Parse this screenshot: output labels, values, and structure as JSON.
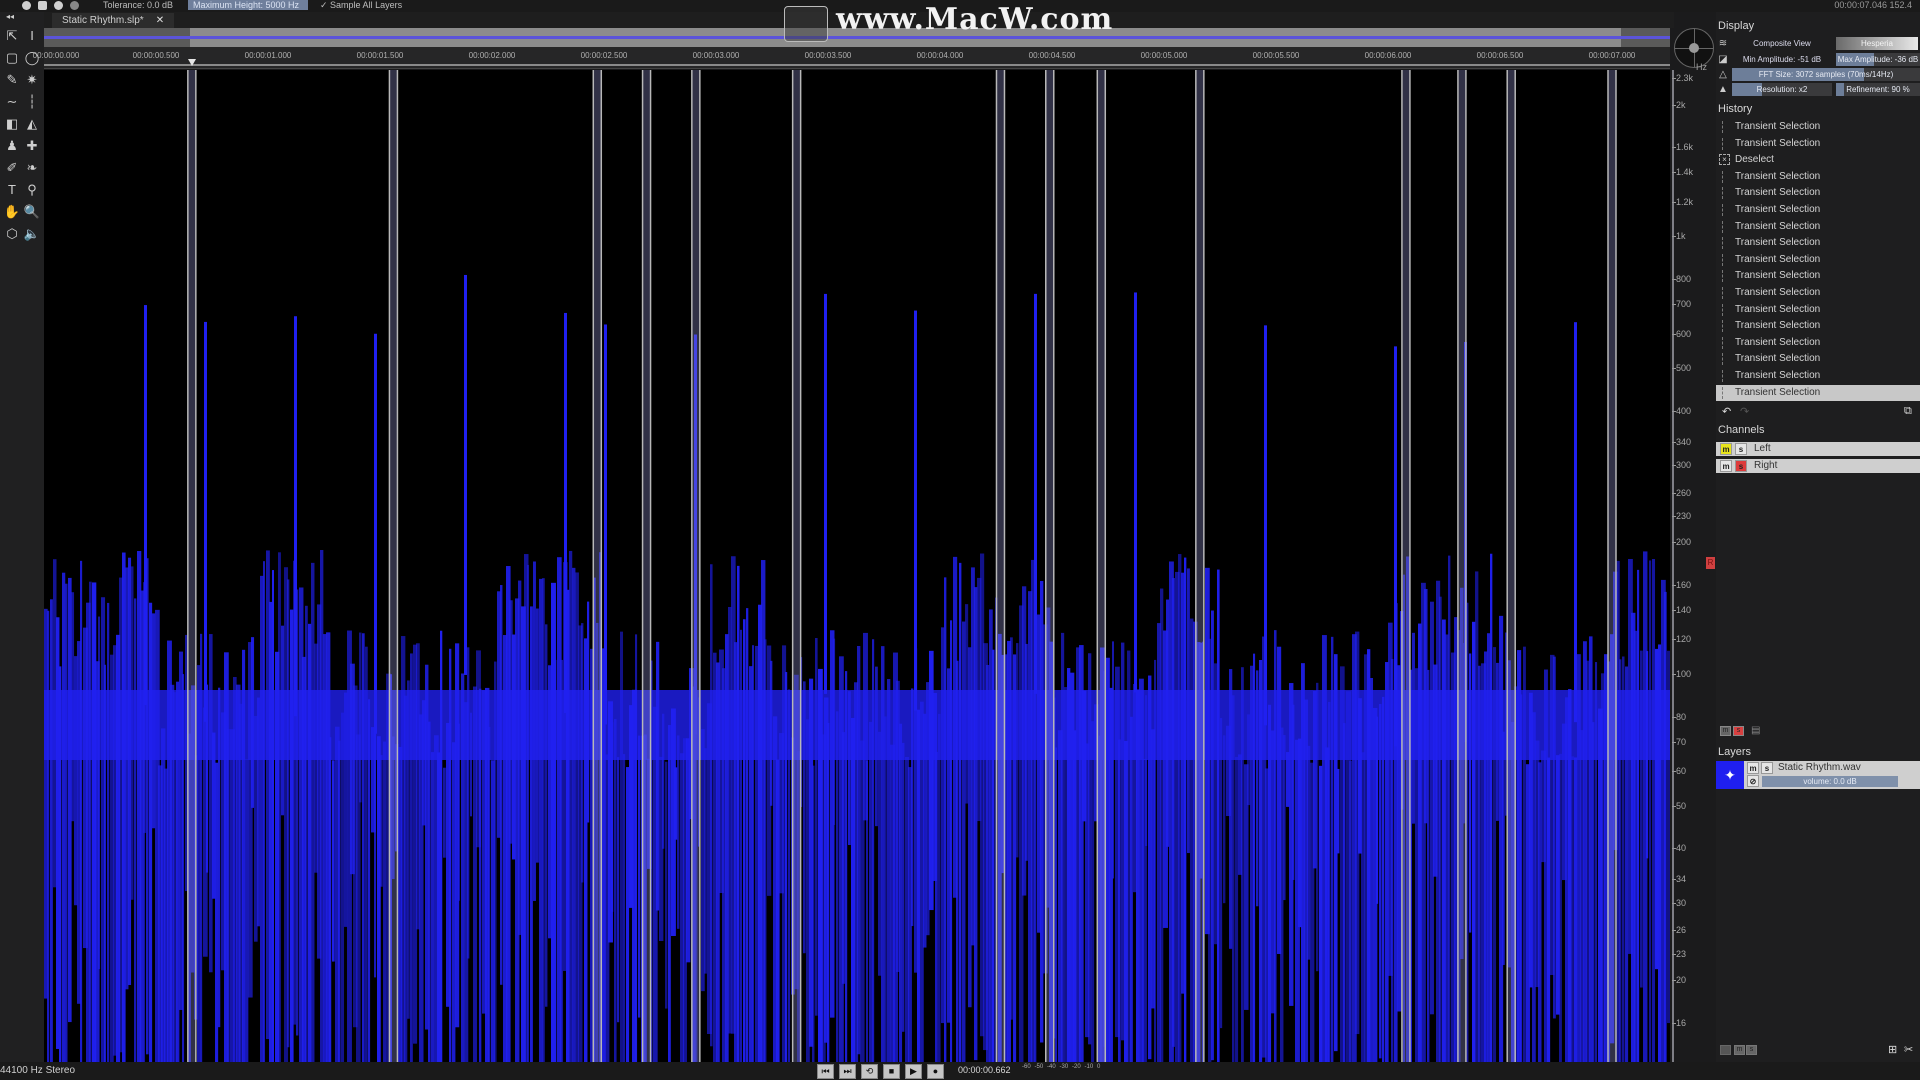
{
  "options_bar": {
    "tolerance": "Tolerance: 0.0 dB",
    "max_height": "Maximum Height: 5000 Hz",
    "sample_all_layers": "✓ Sample All Layers",
    "cursor_time": "00:00:07.046  152.4"
  },
  "watermark": "www.MacW.com",
  "document_tab": {
    "title": "Static Rhythm.slp*",
    "close": "✕"
  },
  "overview": {
    "visible_start_fraction": 0.09,
    "visible_end_fraction": 0.97
  },
  "ruler": {
    "labels": [
      "00:00:00.000",
      "00:00:00.500",
      "00:00:01.000",
      "00:00:01.500",
      "00:00:02.000",
      "00:00:02.500",
      "00:00:03.000",
      "00:00:03.500",
      "00:00:04.000",
      "00:00:04.500",
      "00:00:05.000",
      "00:00:05.500",
      "00:00:06.000",
      "00:00:06.500",
      "00:00:07.000"
    ],
    "playhead_seconds": 0.662
  },
  "tools": [
    {
      "name": "move-tool",
      "glyph": "⇱"
    },
    {
      "name": "time-selection-tool",
      "glyph": "I"
    },
    {
      "name": "rectangle-select-tool",
      "glyph": "▢"
    },
    {
      "name": "lasso-tool",
      "glyph": "◯"
    },
    {
      "name": "brush-select-tool",
      "glyph": "✎"
    },
    {
      "name": "magic-wand-tool",
      "glyph": "✷"
    },
    {
      "name": "harmonic-select-tool",
      "glyph": "∼"
    },
    {
      "name": "transient-select-tool",
      "glyph": "┆"
    },
    {
      "name": "eraser-tool",
      "glyph": "◧"
    },
    {
      "name": "smudge-tool",
      "glyph": "◭"
    },
    {
      "name": "clone-stamp-tool",
      "glyph": "♟"
    },
    {
      "name": "healing-tool",
      "glyph": "✚"
    },
    {
      "name": "pencil-tool",
      "glyph": "✐"
    },
    {
      "name": "spray-tool",
      "glyph": "❧"
    },
    {
      "name": "text-tool",
      "glyph": "T"
    },
    {
      "name": "eyedropper-tool",
      "glyph": "⚲"
    },
    {
      "name": "hand-tool",
      "glyph": "✋"
    },
    {
      "name": "zoom-tool",
      "glyph": "🔍"
    },
    {
      "name": "cube-tool",
      "glyph": "⬡"
    },
    {
      "name": "speaker-tool",
      "glyph": "🔈"
    }
  ],
  "frequency_axis": {
    "unit": "Hz",
    "labels": [
      "2.3k",
      "2k",
      "1.6k",
      "1.4k",
      "1.2k",
      "1k",
      "800",
      "700",
      "600",
      "500",
      "400",
      "340",
      "300",
      "260",
      "230",
      "200",
      "160",
      "140",
      "120",
      "100",
      "80",
      "70",
      "60",
      "50",
      "40",
      "34",
      "30",
      "26",
      "23",
      "20",
      "16"
    ],
    "channel_badge": "R"
  },
  "spectrogram": {
    "color": "#2020f0",
    "transient_markers_seconds": [
      0.66,
      1.56,
      2.47,
      2.69,
      2.91,
      3.36,
      4.27,
      4.49,
      4.72,
      5.16,
      6.08,
      6.33,
      6.55,
      7.0
    ]
  },
  "display": {
    "title": "Display",
    "view_mode": "Composite View",
    "colormap": "Hesperia",
    "min_amplitude": "Min Amplitude: -51 dB",
    "max_amplitude": "Max Amplitude: -36 dB",
    "max_amplitude_fill": 0.45,
    "fft_size": "FFT Size: 3072 samples (70ms/14Hz)",
    "fft_size_fill": 0.7,
    "resolution": "Resolution: x2",
    "resolution_fill": 0.3,
    "refinement": "Refinement: 90 %",
    "refinement_fill": 0.1
  },
  "history": {
    "title": "History",
    "items": [
      {
        "label": "Transient Selection",
        "type": "transient"
      },
      {
        "label": "Transient Selection",
        "type": "transient"
      },
      {
        "label": "Deselect",
        "type": "deselect"
      },
      {
        "label": "Transient Selection",
        "type": "transient"
      },
      {
        "label": "Transient Selection",
        "type": "transient"
      },
      {
        "label": "Transient Selection",
        "type": "transient"
      },
      {
        "label": "Transient Selection",
        "type": "transient"
      },
      {
        "label": "Transient Selection",
        "type": "transient"
      },
      {
        "label": "Transient Selection",
        "type": "transient"
      },
      {
        "label": "Transient Selection",
        "type": "transient"
      },
      {
        "label": "Transient Selection",
        "type": "transient"
      },
      {
        "label": "Transient Selection",
        "type": "transient"
      },
      {
        "label": "Transient Selection",
        "type": "transient"
      },
      {
        "label": "Transient Selection",
        "type": "transient"
      },
      {
        "label": "Transient Selection",
        "type": "transient"
      },
      {
        "label": "Transient Selection",
        "type": "transient"
      },
      {
        "label": "Transient Selection",
        "type": "transient",
        "active": true
      }
    ],
    "undo": "↶",
    "redo": "↷",
    "snapshot": "⧉"
  },
  "channels": {
    "title": "Channels",
    "items": [
      {
        "name": "Left",
        "mute_label": "m",
        "solo_label": "s",
        "mute_on": true,
        "solo_on": false
      },
      {
        "name": "Right",
        "mute_label": "m",
        "solo_label": "s",
        "mute_on": false,
        "solo_on": true
      }
    ],
    "footer": {
      "m": "m",
      "s": "s",
      "extra": "▤"
    }
  },
  "layers": {
    "title": "Layers",
    "items": [
      {
        "name": "Static Rhythm.wav",
        "volume": "volume: 0.0 dB",
        "mute_label": "m",
        "solo_label": "s"
      }
    ],
    "footer": {
      "m": "m",
      "s": "s",
      "new_layer": "⊞",
      "delete_layer": "✂"
    }
  },
  "status": {
    "format": "44100 Hz Stereo"
  },
  "transport": {
    "buttons": [
      {
        "name": "go-to-start-button",
        "glyph": "⏮"
      },
      {
        "name": "go-to-end-button",
        "glyph": "⏭"
      },
      {
        "name": "loop-button",
        "glyph": "⟲"
      },
      {
        "name": "stop-button",
        "glyph": "■"
      },
      {
        "name": "play-button",
        "glyph": "▶"
      },
      {
        "name": "record-button",
        "glyph": "●"
      }
    ],
    "time": "00:00:00.662",
    "meter_labels": [
      "-60",
      "-50",
      "-40",
      "-30",
      "-20",
      "-10",
      "0"
    ]
  }
}
